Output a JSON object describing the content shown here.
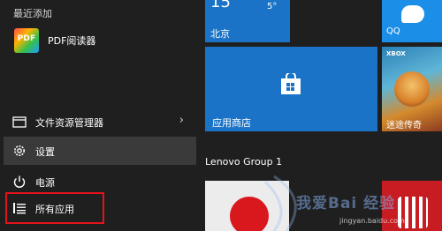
{
  "left_menu": {
    "section_label": "最近添加",
    "recent_app": {
      "label": "PDF阅读器",
      "icon_text": "PDF",
      "icon": "pdf-reader-icon"
    },
    "items": [
      {
        "label": "文件资源管理器",
        "icon": "folder-icon",
        "has_chevron": true,
        "chevron": "›"
      },
      {
        "label": "设置",
        "icon": "gear-icon"
      },
      {
        "label": "电源",
        "icon": "power-icon"
      },
      {
        "label": "所有应用",
        "icon": "list-icon"
      }
    ]
  },
  "tiles": {
    "weather": {
      "temp": "15",
      "deg": "5°",
      "city": "北京"
    },
    "qq": {
      "label": "QQ"
    },
    "store": {
      "label": "应用商店",
      "icon": "shopping-bag-icon"
    },
    "xbox": {
      "badge": "XBOX",
      "label": "迷途传奇"
    }
  },
  "group": {
    "title": "Lenovo Group 1"
  },
  "watermark": {
    "text": "我爱Bai 经验",
    "url": "jingyan.baidu.com"
  },
  "colors": {
    "accent": "#1a73c7",
    "highlight_box": "#e3131a",
    "background": "#1f1f1f"
  }
}
